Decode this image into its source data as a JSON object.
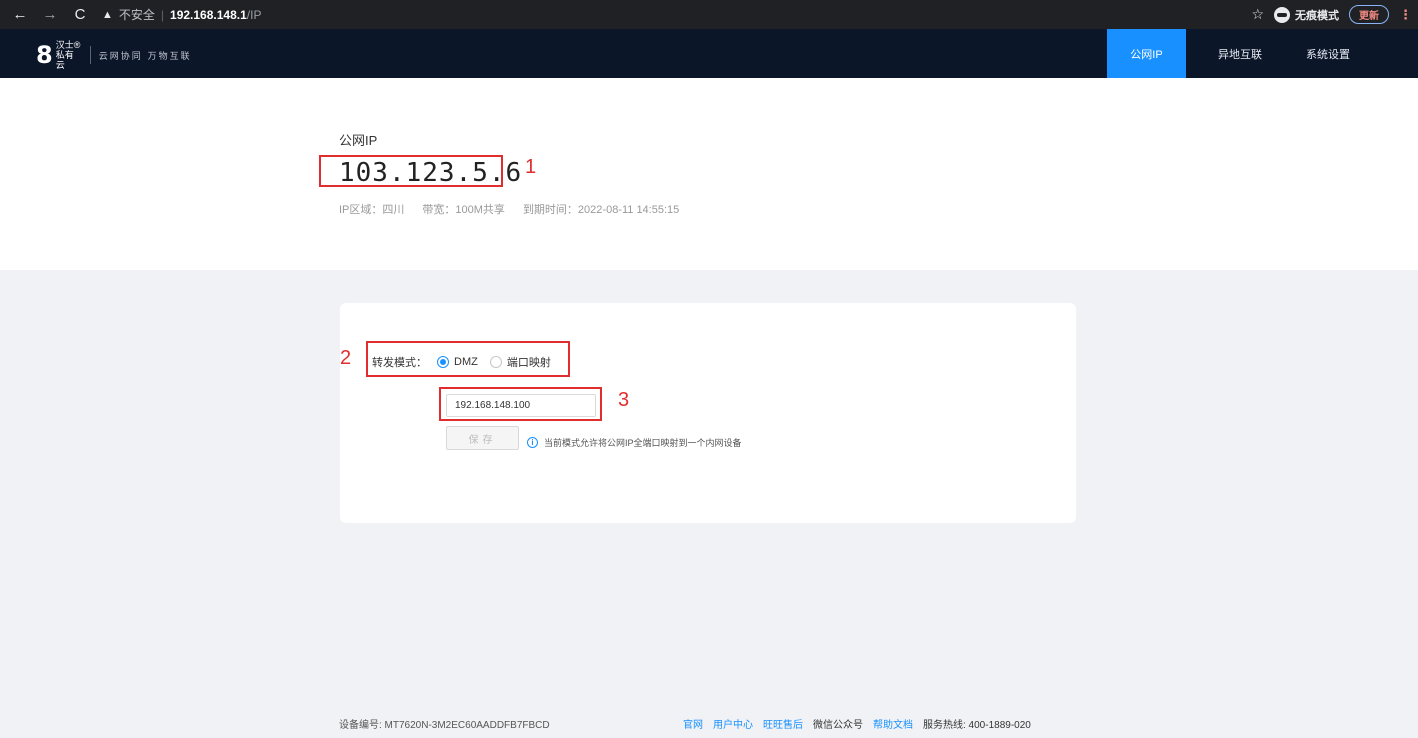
{
  "browser": {
    "back_icon": "←",
    "forward_icon": "→",
    "reload_icon": "C",
    "warning_icon": "▲",
    "insecure_label": "不安全",
    "separator": "|",
    "url_host": "192.168.148.1",
    "url_path": "/IP",
    "star_icon": "☆",
    "incognito_label": "无痕模式",
    "update_label": "更新",
    "menu_icon": "⋮"
  },
  "header": {
    "logo_mark": "8",
    "logo_brand": "汉士®私有云",
    "slogan": "云网协同 万物互联",
    "tabs": [
      {
        "label": "公网IP",
        "active": true
      },
      {
        "label": "异地互联",
        "active": false
      },
      {
        "label": "系统设置",
        "active": false
      }
    ]
  },
  "hero": {
    "label": "公网IP",
    "ip": "103.123.5.6",
    "region": "IP区域：四川",
    "bandwidth": "带宽：100M共享",
    "expiry": "到期时间：2022-08-11 14:55:15"
  },
  "annotations": [
    "1",
    "2",
    "3"
  ],
  "form": {
    "mode_label": "转发模式：",
    "options": [
      {
        "label": "DMZ",
        "checked": true
      },
      {
        "label": "端口映射",
        "checked": false
      }
    ],
    "ip_value": "192.168.148.100",
    "save_label": "保存",
    "info_icon": "i",
    "hint": "当前模式允许将公网IP全端口映射到一个内网设备"
  },
  "footer": {
    "device_id": "设备编号: MT7620N-3M2EC60AADDFB7FBCD",
    "links": [
      "官网",
      "用户中心",
      "旺旺售后"
    ],
    "wechat": "微信公众号",
    "help": "帮助文档",
    "hotline": "服务热线: 400-1889-020"
  },
  "colors": {
    "accent": "#1890ff",
    "header_bg": "#0c1629",
    "annotation": "#e02e2e",
    "page_bg": "#f0f2f5"
  }
}
